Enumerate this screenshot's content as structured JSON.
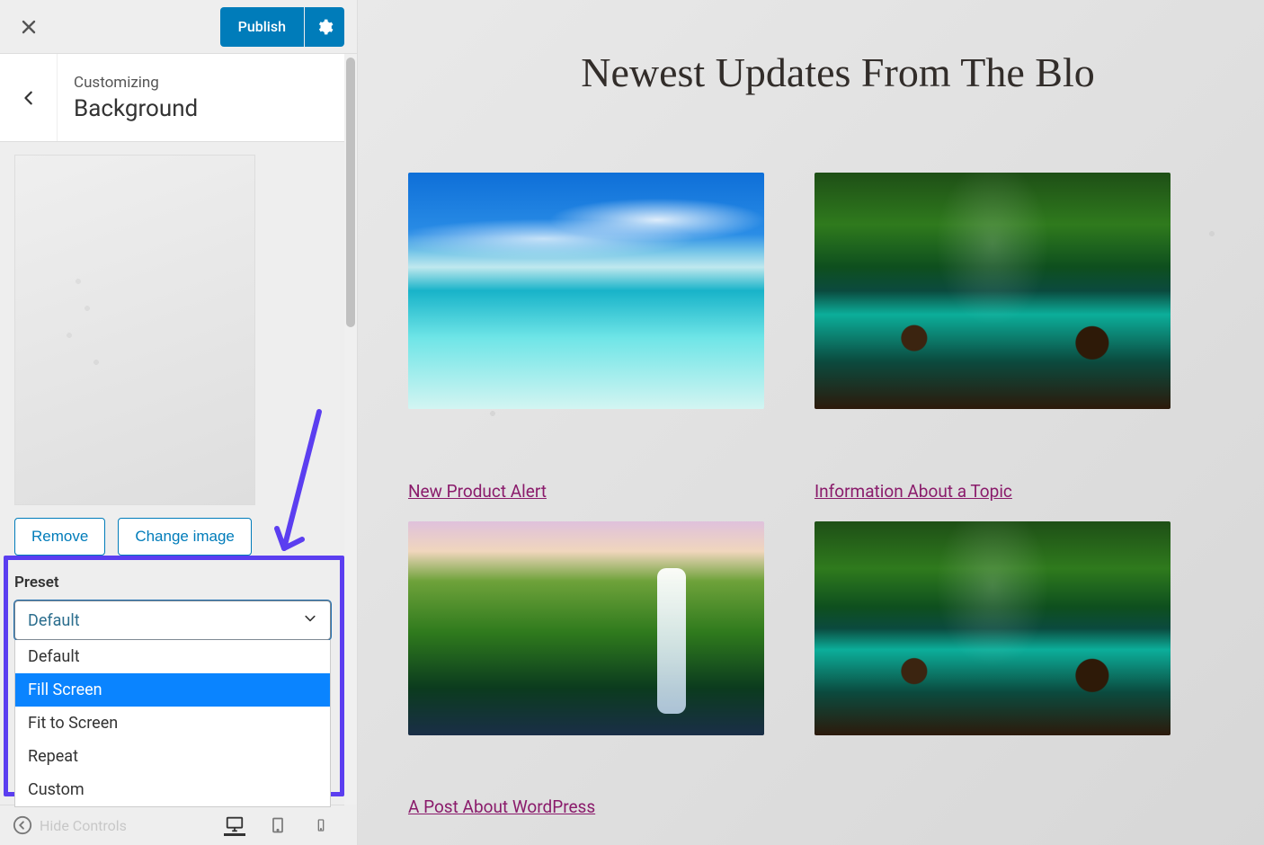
{
  "topbar": {
    "publish_label": "Publish"
  },
  "section": {
    "eyebrow": "Customizing",
    "title": "Background"
  },
  "buttons": {
    "remove": "Remove",
    "change_image": "Change image"
  },
  "preset": {
    "label": "Preset",
    "selected": "Default",
    "options": [
      "Default",
      "Fill Screen",
      "Fit to Screen",
      "Repeat",
      "Custom"
    ],
    "highlighted_index": 1
  },
  "footer": {
    "hide_controls": "Hide Controls"
  },
  "preview": {
    "heading": "Newest Updates From The Blo",
    "cards": [
      {
        "caption": "New Product Alert"
      },
      {
        "caption": "Information About a Topic"
      },
      {
        "caption": "A Post About WordPress"
      }
    ]
  }
}
